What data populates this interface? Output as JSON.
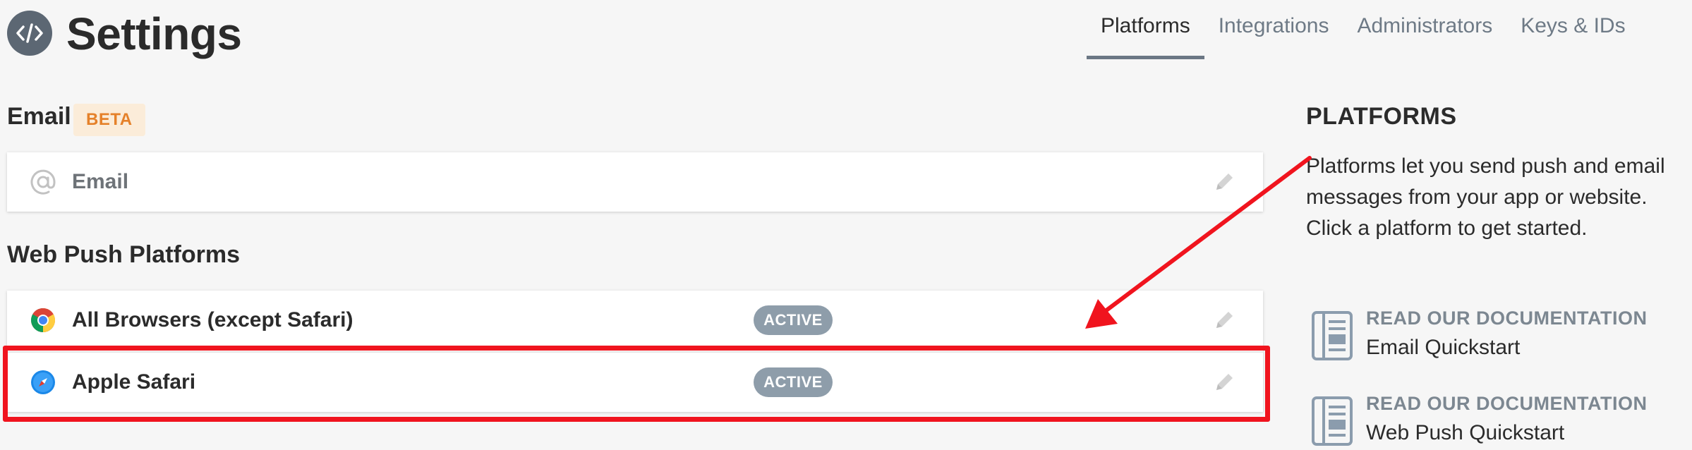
{
  "header": {
    "title": "Settings",
    "logo_icon": "code-icon",
    "tabs": [
      {
        "label": "Platforms",
        "active": true
      },
      {
        "label": "Integrations",
        "active": false
      },
      {
        "label": "Administrators",
        "active": false
      },
      {
        "label": "Keys & IDs",
        "active": false
      }
    ]
  },
  "email_section": {
    "title": "Email",
    "badge": "BETA",
    "platforms": [
      {
        "label": "Email",
        "icon": "at-sign-icon",
        "status": null,
        "edit_icon": "pencil-icon"
      }
    ]
  },
  "web_push_section": {
    "title": "Web Push Platforms",
    "platforms": [
      {
        "label": "All Browsers (except Safari)",
        "icon": "chrome-icon",
        "status": "ACTIVE",
        "edit_icon": "pencil-icon"
      },
      {
        "label": "Apple Safari",
        "icon": "safari-icon",
        "status": "ACTIVE",
        "edit_icon": "pencil-icon"
      }
    ]
  },
  "sidebar": {
    "title": "PLATFORMS",
    "description": "Platforms let you send push and email messages from your app or website. Click a platform to get started.",
    "docs": [
      {
        "kicker": "READ OUR DOCUMENTATION",
        "title": "Email Quickstart",
        "icon": "document-icon"
      },
      {
        "kicker": "READ OUR DOCUMENTATION",
        "title": "Web Push Quickstart",
        "icon": "document-icon"
      }
    ]
  },
  "colors": {
    "annotation": "#f0141e",
    "badge_active": "#8e9daa",
    "beta_bg": "#fbecd9",
    "beta_text": "#e5812a"
  }
}
